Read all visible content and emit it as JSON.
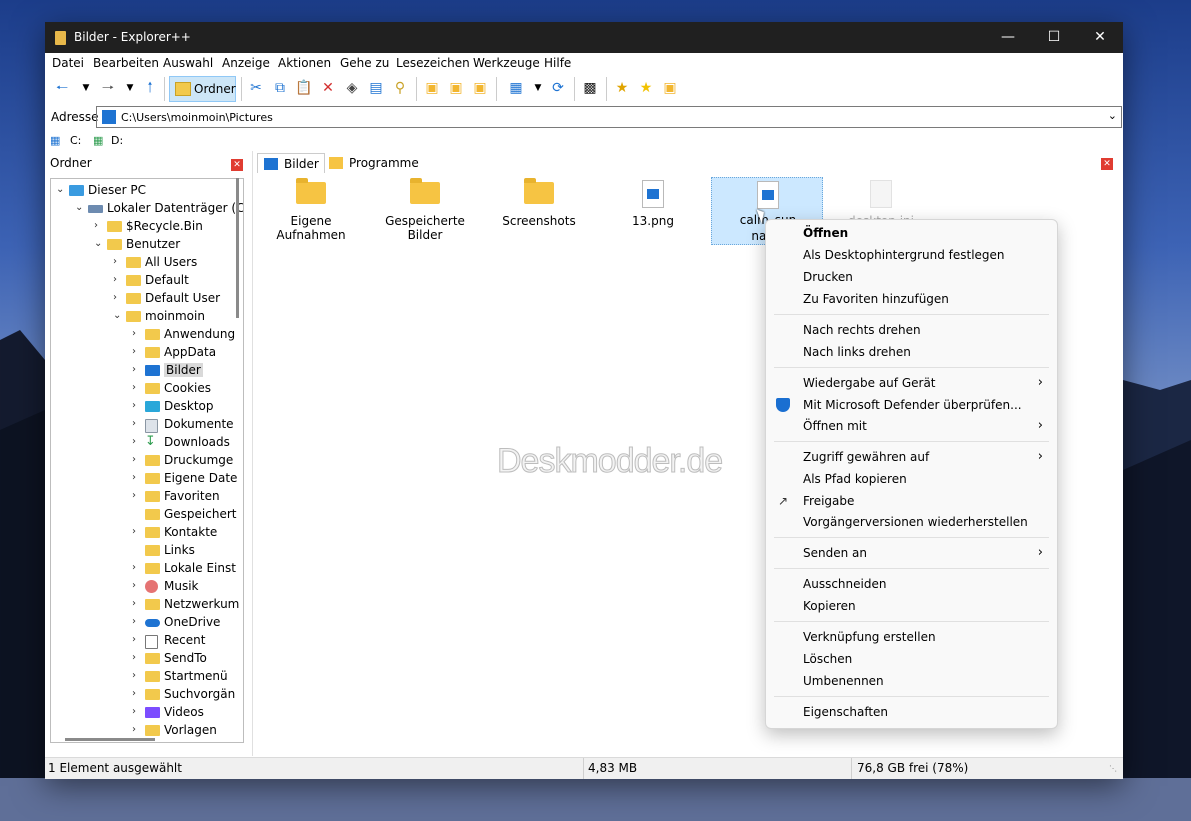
{
  "window": {
    "title": "Bilder - Explorer++"
  },
  "menu": [
    "Datei",
    "Bearbeiten",
    "Auswahl",
    "Anzeige",
    "Aktionen",
    "Gehe zu",
    "Lesezeichen",
    "Werkzeuge",
    "Hilfe"
  ],
  "toolbar": {
    "folders_label": "Ordner"
  },
  "address": {
    "label": "Adresse",
    "value": "C:\\Users\\moinmoin\\Pictures"
  },
  "drives": [
    "C:",
    "D:"
  ],
  "tree": {
    "header": "Ordner",
    "items": [
      {
        "label": "Dieser PC"
      },
      {
        "label": "Lokaler Datenträger (C:"
      },
      {
        "label": "$Recycle.Bin"
      },
      {
        "label": "Benutzer"
      },
      {
        "label": "All Users"
      },
      {
        "label": "Default"
      },
      {
        "label": "Default User"
      },
      {
        "label": "moinmoin"
      },
      {
        "label": "Anwendung"
      },
      {
        "label": "AppData"
      },
      {
        "label": "Bilder"
      },
      {
        "label": "Cookies"
      },
      {
        "label": "Desktop"
      },
      {
        "label": "Dokumente"
      },
      {
        "label": "Downloads"
      },
      {
        "label": "Druckumge"
      },
      {
        "label": "Eigene Date"
      },
      {
        "label": "Favoriten"
      },
      {
        "label": "Gespeichert"
      },
      {
        "label": "Kontakte"
      },
      {
        "label": "Links"
      },
      {
        "label": "Lokale Einst"
      },
      {
        "label": "Musik"
      },
      {
        "label": "Netzwerkum"
      },
      {
        "label": "OneDrive"
      },
      {
        "label": "Recent"
      },
      {
        "label": "SendTo"
      },
      {
        "label": "Startmenü"
      },
      {
        "label": "Suchvorgän"
      },
      {
        "label": "Videos"
      },
      {
        "label": "Vorlagen"
      }
    ]
  },
  "tabs": [
    "Bilder",
    "Programme"
  ],
  "files": [
    {
      "name": "Eigene Aufnahmen"
    },
    {
      "name": "Gespeicherte Bilder"
    },
    {
      "name": "Screenshots"
    },
    {
      "name": "13.png"
    },
    {
      "name_line1": "calm_sun",
      "name_line2": "nabia"
    },
    {
      "name": "desktop.ini"
    }
  ],
  "watermark": "Deskmodder.de",
  "status": {
    "selection": "1 Element ausgewählt",
    "size": "4,83 MB",
    "free": "76,8 GB frei (78%)"
  },
  "context_menu": {
    "items": [
      "Öffnen",
      "Als Desktophintergrund festlegen",
      "Drucken",
      "Zu Favoriten hinzufügen",
      "Nach rechts drehen",
      "Nach links drehen",
      "Wiedergabe auf Gerät",
      "Mit Microsoft Defender überprüfen...",
      "Öffnen mit",
      "Zugriff gewähren auf",
      "Als Pfad kopieren",
      "Freigabe",
      "Vorgängerversionen wiederherstellen",
      "Senden an",
      "Ausschneiden",
      "Kopieren",
      "Verknüpfung erstellen",
      "Löschen",
      "Umbenennen",
      "Eigenschaften"
    ]
  },
  "colors": {
    "titlebar": "#202020",
    "accent": "#1e73d2",
    "folder": "#f6c443",
    "selection": "#cce8ff",
    "close_red": "#e03c31"
  }
}
